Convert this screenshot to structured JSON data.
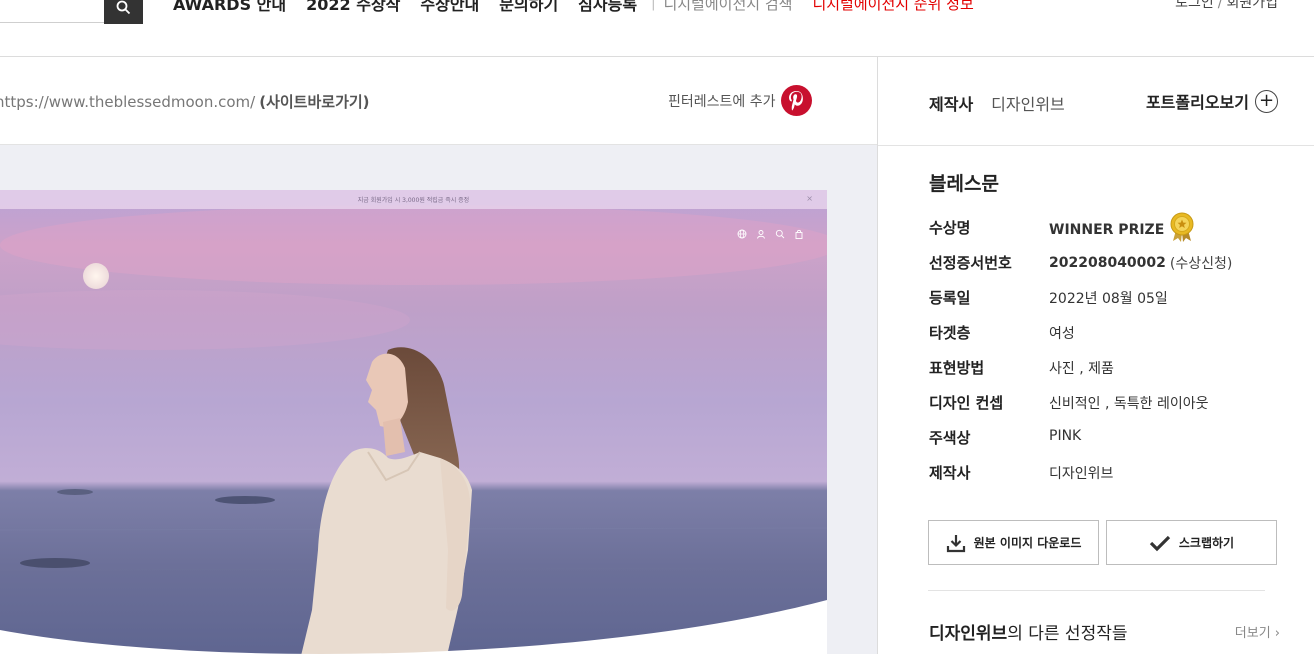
{
  "nav": {
    "items": [
      "AWARDS 안내",
      "2022 수상작",
      "수상안내",
      "문의하기",
      "심사등록"
    ],
    "agency_search": "디지털에이전시 검색",
    "agency_rank": "디지털에이전시 순위 정보",
    "login": "로그인",
    "auth_separator": "/",
    "signup": "회원가입"
  },
  "urlbar": {
    "url": "https://www.theblessedmoon.com/",
    "visit": "(사이트바로가기)",
    "pinterest": "핀터레스트에 추가"
  },
  "preview": {
    "banner": "지금 회원가입 시 3,000원 적립금 즉시 증정",
    "close": "×"
  },
  "panel": {
    "maker_label": "제작사",
    "maker_name": "디자인위브",
    "portfolio": "포트폴리오보기",
    "title": "블레스문",
    "info": [
      {
        "label": "수상명",
        "value": "WINNER PRIZE"
      },
      {
        "label": "선정증서번호",
        "value": "202208040002",
        "suffix": "(수상신청)"
      },
      {
        "label": "등록일",
        "value": "2022년 08월 05일"
      },
      {
        "label": "타겟층",
        "value": "여성"
      },
      {
        "label": "표현방법",
        "value": "사진 , 제품"
      },
      {
        "label": "디자인 컨셉",
        "value": "신비적인 , 독특한 레이아웃"
      },
      {
        "label": "주색상",
        "value": "PINK"
      },
      {
        "label": "제작사",
        "value": "디자인위브"
      }
    ],
    "download": "원본 이미지 다운로드",
    "scrap": "스크랩하기",
    "others_agency": "디자인위브",
    "others_rest": "의 다른 선정작들",
    "more": "더보기 ›"
  },
  "colors": {
    "accent_red": "#e20000",
    "pinterest": "#c8102e",
    "medal": "#e8b923"
  }
}
